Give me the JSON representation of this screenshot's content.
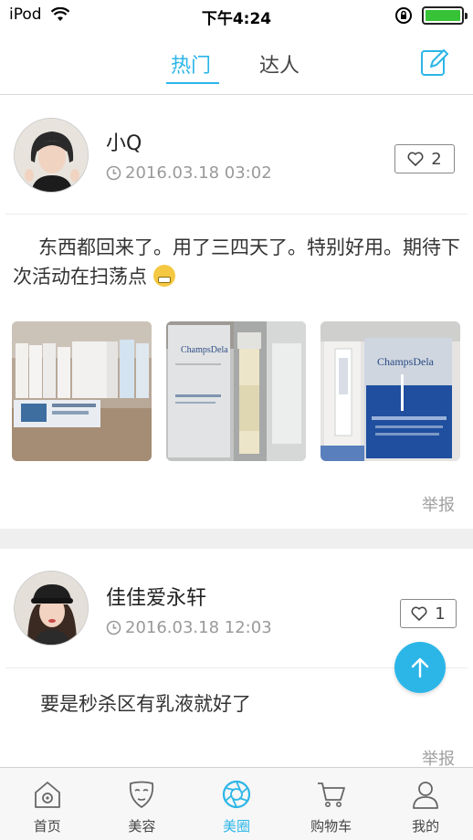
{
  "status_bar": {
    "carrier": "iPod",
    "time": "下午4:24"
  },
  "top_nav": {
    "tabs": [
      {
        "label": "热门",
        "active": true
      },
      {
        "label": "达人",
        "active": false
      }
    ],
    "edit_icon": "edit-icon"
  },
  "posts": [
    {
      "username": "小Q",
      "time": "2016.03.18 03:02",
      "likes": "2",
      "text": "东西都回来了。用了三四天了。特别好用。期待下次活动在扫荡点",
      "photo_labels": [
        "ChampsDela",
        "ChampsDela"
      ],
      "report": "举报"
    },
    {
      "username": "佳佳爱永轩",
      "time": "2016.03.18 12:03",
      "likes": "1",
      "text": "要是秒杀区有乳液就好了",
      "report": "举报"
    }
  ],
  "tabbar": {
    "items": [
      {
        "label": "首页",
        "icon": "home-icon",
        "active": false
      },
      {
        "label": "美容",
        "icon": "face-mask-icon",
        "active": false
      },
      {
        "label": "美圈",
        "icon": "aperture-icon",
        "active": true
      },
      {
        "label": "购物车",
        "icon": "cart-icon",
        "active": false
      },
      {
        "label": "我的",
        "icon": "profile-icon",
        "active": false
      }
    ]
  },
  "colors": {
    "accent": "#2cb6e8",
    "battery": "#37c237"
  }
}
